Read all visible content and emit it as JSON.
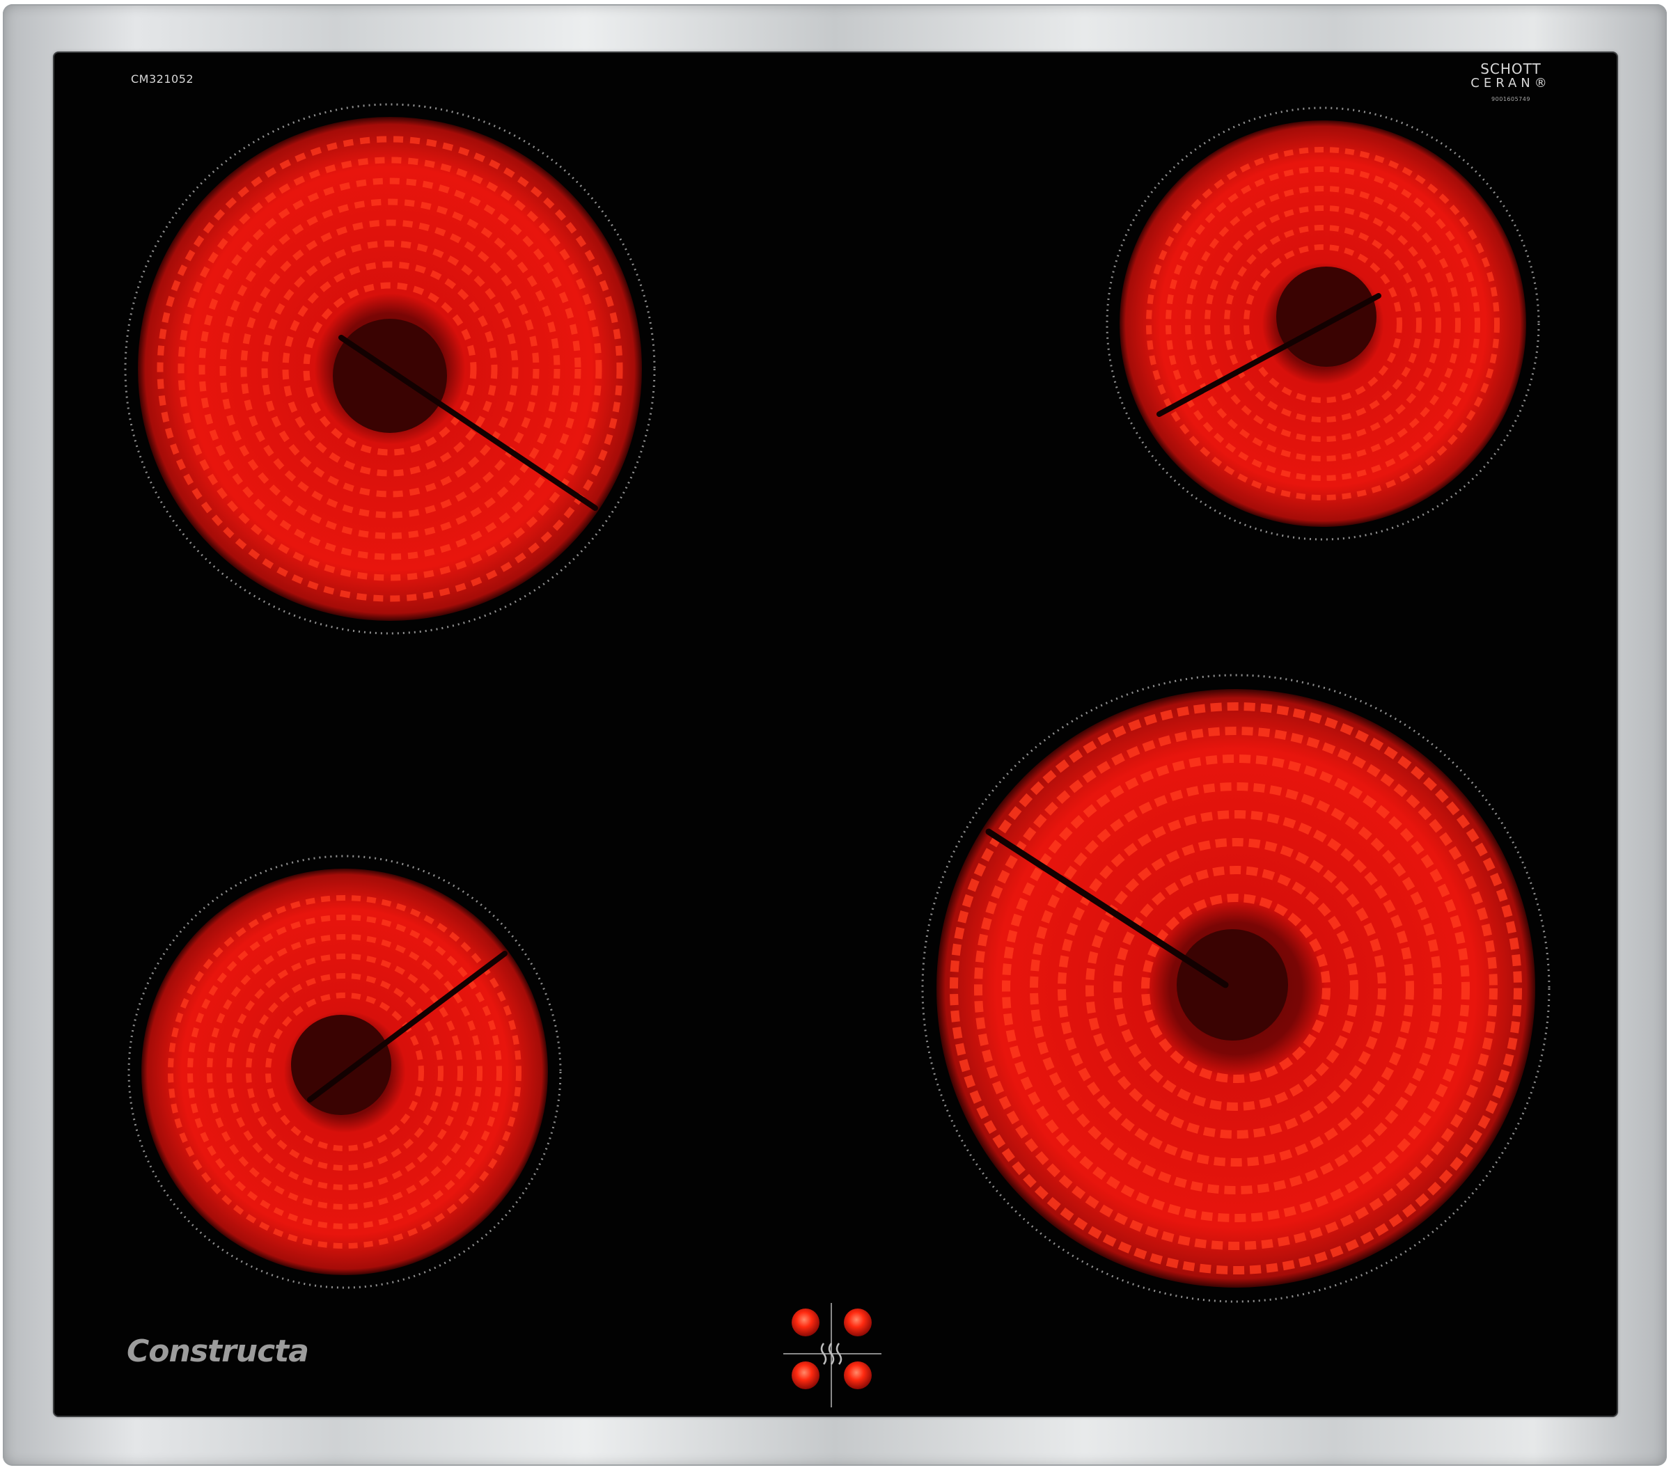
{
  "hob": {
    "model_number": "CM321052",
    "glass_maker_line1": "SCHOTT",
    "glass_maker_line2": "CERAN®",
    "glass_serial": "9001605749",
    "brand_name": "Constructa"
  },
  "zones": [
    {
      "name": "rear-left",
      "state": "on"
    },
    {
      "name": "rear-right",
      "state": "on"
    },
    {
      "name": "front-left",
      "state": "on"
    },
    {
      "name": "front-right",
      "state": "on"
    }
  ],
  "indicators": {
    "lights": [
      "rear-left",
      "rear-right",
      "front-left",
      "front-right"
    ],
    "symbol": "heat-waves-icon"
  },
  "colors": {
    "glow": "#e8120c",
    "glass": "#020202",
    "frame": "#d5d8da"
  }
}
